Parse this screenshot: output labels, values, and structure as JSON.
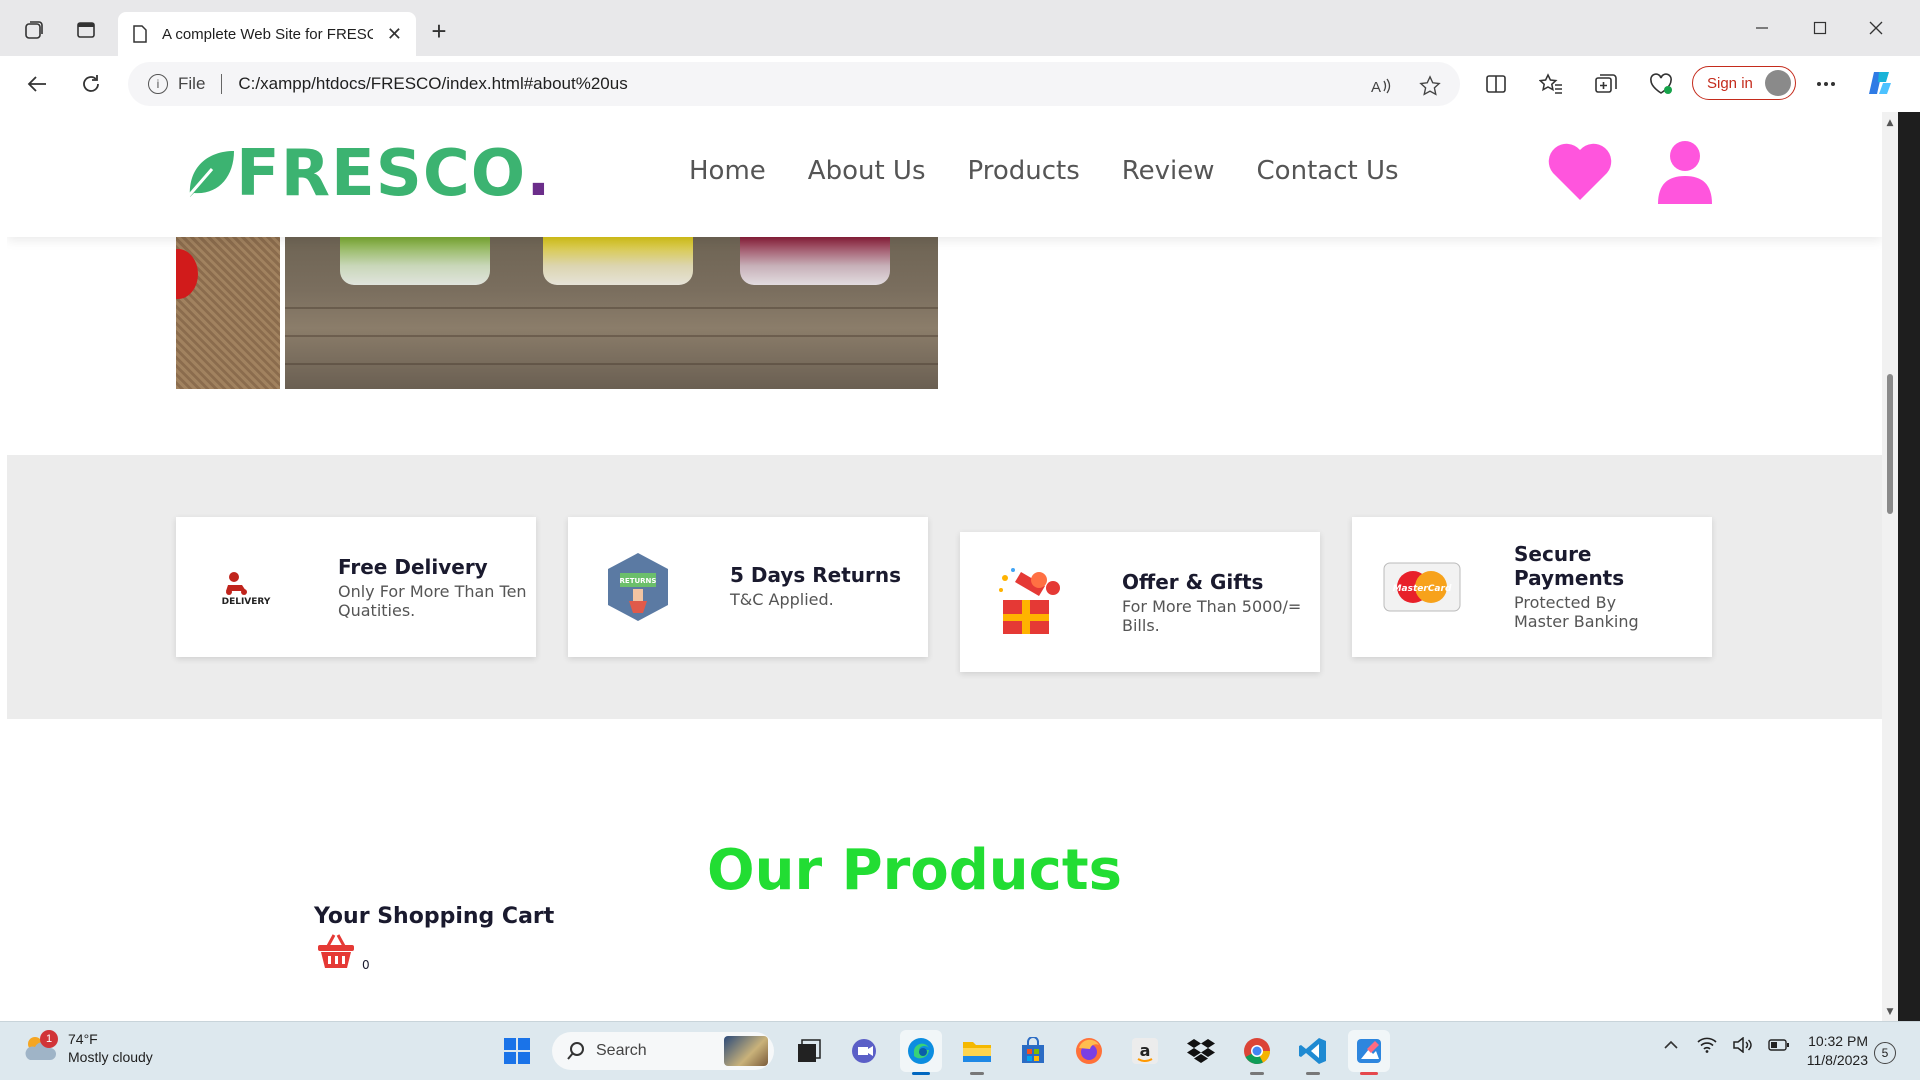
{
  "browser": {
    "tab_title": "A complete Web Site for FRESCO",
    "new_tab_symbol": "+",
    "address": {
      "scheme_label": "File",
      "url": "C:/xampp/htdocs/FRESCO/index.html#about%20us"
    },
    "sign_in_label": "Sign in"
  },
  "site": {
    "logo_text": "FRESCO",
    "logo_dot": ".",
    "brand_color": "#3cb371",
    "accent_color": "#ff55dd",
    "nav": [
      {
        "label": "Home"
      },
      {
        "label": "About Us"
      },
      {
        "label": "Products"
      },
      {
        "label": "Review"
      },
      {
        "label": "Contact Us"
      }
    ],
    "services": [
      {
        "title": "Free Delivery",
        "subtitle": "Only For More Than Ten Quatities.",
        "icon": "delivery-icon",
        "icon_text": "DELIVERY"
      },
      {
        "title": "5 Days Returns",
        "subtitle": "T&C Applied.",
        "icon": "returns-icon",
        "icon_text": "RETURNS"
      },
      {
        "title": "Offer & Gifts",
        "subtitle": "For More Than 5000/= Bills.",
        "icon": "gift-icon"
      },
      {
        "title": "Secure Payments",
        "subtitle": "Protected By Master Banking",
        "icon": "mastercard-icon",
        "icon_text": "MasterCard"
      }
    ],
    "products_title": "Our Products",
    "products_title_color": "#22dd33",
    "cart_title": "Your Shopping Cart",
    "cart_count": "0"
  },
  "taskbar": {
    "weather_temp": "74°F",
    "weather_desc": "Mostly cloudy",
    "weather_badge": "1",
    "search_label": "Search",
    "time": "10:32 PM",
    "date": "11/8/2023",
    "notifications": "5"
  }
}
